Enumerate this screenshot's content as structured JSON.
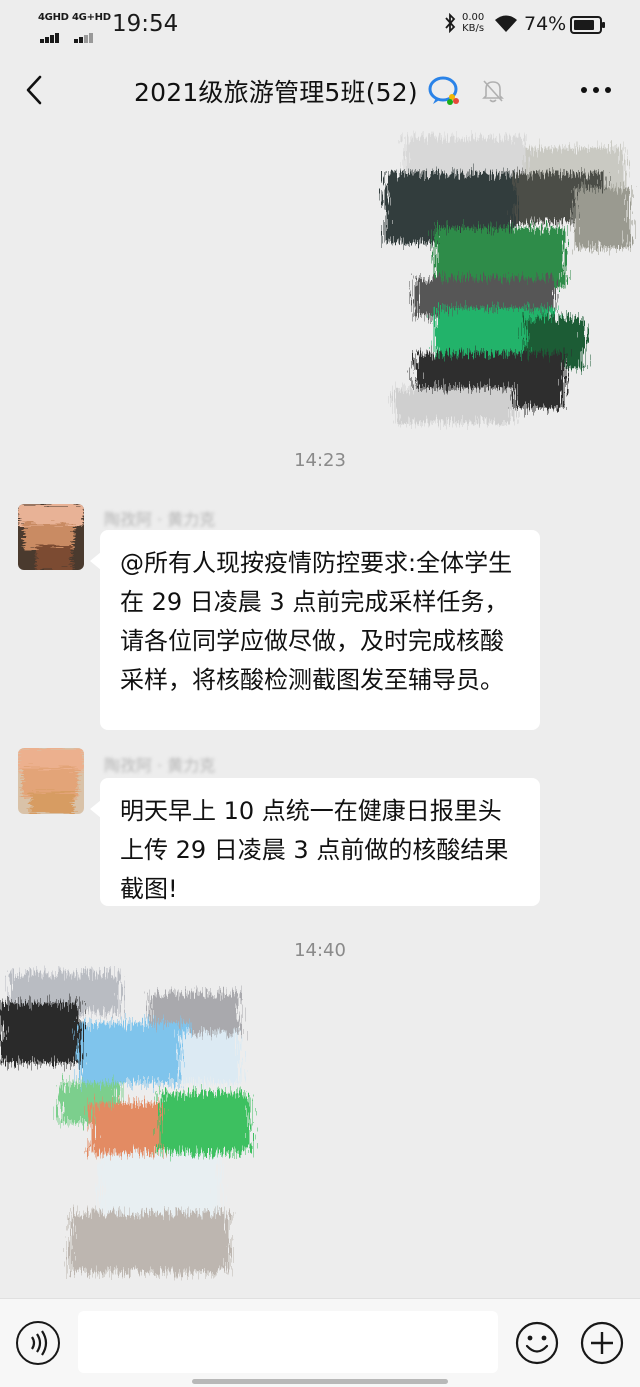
{
  "status_bar": {
    "network_1": "4GHD",
    "network_2": "4G+HD",
    "time": "19:54",
    "speed_value": "0.00",
    "speed_unit": "KB/s",
    "battery": "74%"
  },
  "header": {
    "title": "2021级旅游管理5班(52)",
    "back_icon": "chevron-left-icon",
    "more_icon": "more-dots-icon",
    "badge_icon": "enterprise-chat-icon",
    "mute_icon": "bell-muted-icon"
  },
  "messages": {
    "timestamp_1": "14:23",
    "timestamp_2": "14:40",
    "msg_1": {
      "sender": "陶孜阿 · 黄力克",
      "text": "@所有人现按疫情防控要求:全体学生在 29 日凌晨 3 点前完成采样任务，请各位同学应做尽做，及时完成核酸采样，将核酸检测截图发至辅导员。"
    },
    "msg_2": {
      "sender": "陶孜阿 · 黄力克",
      "text": "明天早上 10 点统一在健康日报里头上传 29 日凌晨 3 点前做的核酸结果截图!"
    }
  },
  "input_bar": {
    "placeholder": "",
    "voice_icon": "voice-icon",
    "emoji_icon": "emoji-icon",
    "plus_icon": "plus-icon"
  },
  "colors": {
    "background": "#ededed",
    "bubble": "#ffffff",
    "timestamp": "#8a8a8a"
  }
}
